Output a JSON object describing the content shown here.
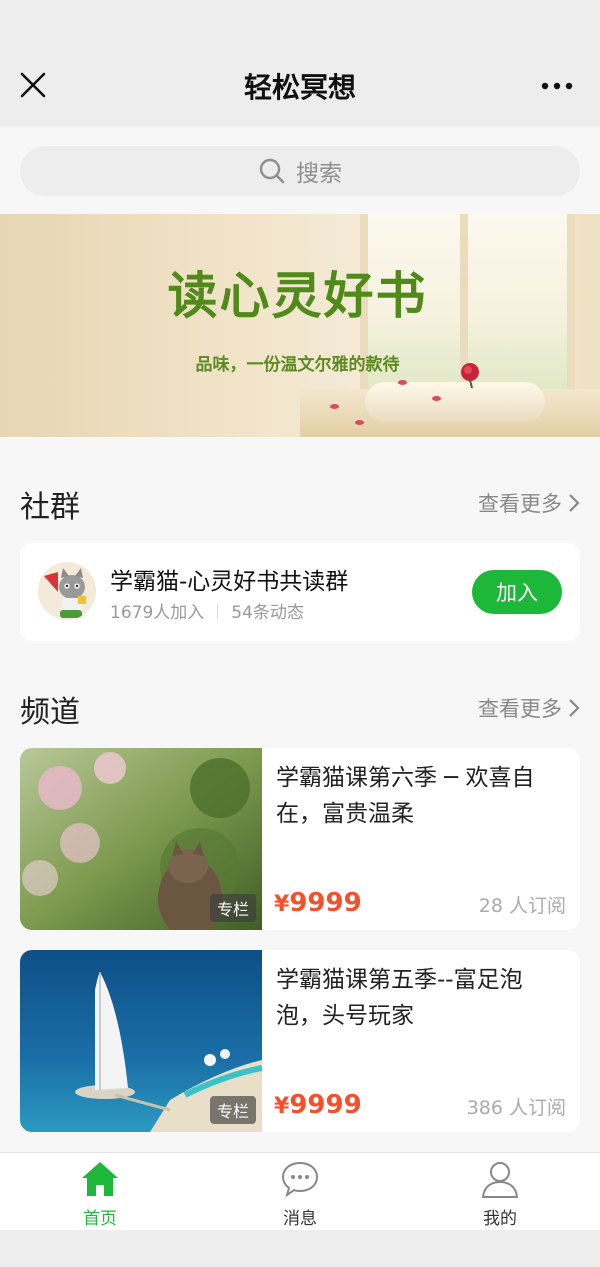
{
  "header": {
    "title": "轻松冥想",
    "close_icon": "close-icon",
    "more_icon": "more-dots-icon"
  },
  "search": {
    "placeholder": "搜索",
    "icon": "search-icon"
  },
  "banner": {
    "title": "读心灵好书",
    "subtitle": "品味，一份温文尔雅的款待",
    "title_color": "#4f8a1a"
  },
  "community": {
    "heading": "社群",
    "more_label": "查看更多",
    "group": {
      "name": "学霸猫-心灵好书共读群",
      "members": "1679人加入",
      "posts": "54条动态",
      "join_label": "加入"
    }
  },
  "channels": {
    "heading": "频道",
    "more_label": "查看更多",
    "items": [
      {
        "title": "学霸猫课第六季 ─ 欢喜自在，富贵温柔",
        "tag": "专栏",
        "currency": "¥",
        "price": "9999",
        "subscribers": "28 人订阅"
      },
      {
        "title": "学霸猫课第五季--富足泡泡，头号玩家",
        "tag": "专栏",
        "currency": "¥",
        "price": "9999",
        "subscribers": "386 人订阅"
      }
    ]
  },
  "tabbar": {
    "items": [
      {
        "label": "首页",
        "icon": "home-icon",
        "active": true
      },
      {
        "label": "消息",
        "icon": "message-icon",
        "active": false
      },
      {
        "label": "我的",
        "icon": "profile-icon",
        "active": false
      }
    ]
  },
  "colors": {
    "accent_green": "#1db83a",
    "price_red": "#f5502a",
    "background": "#f7f7f7"
  }
}
